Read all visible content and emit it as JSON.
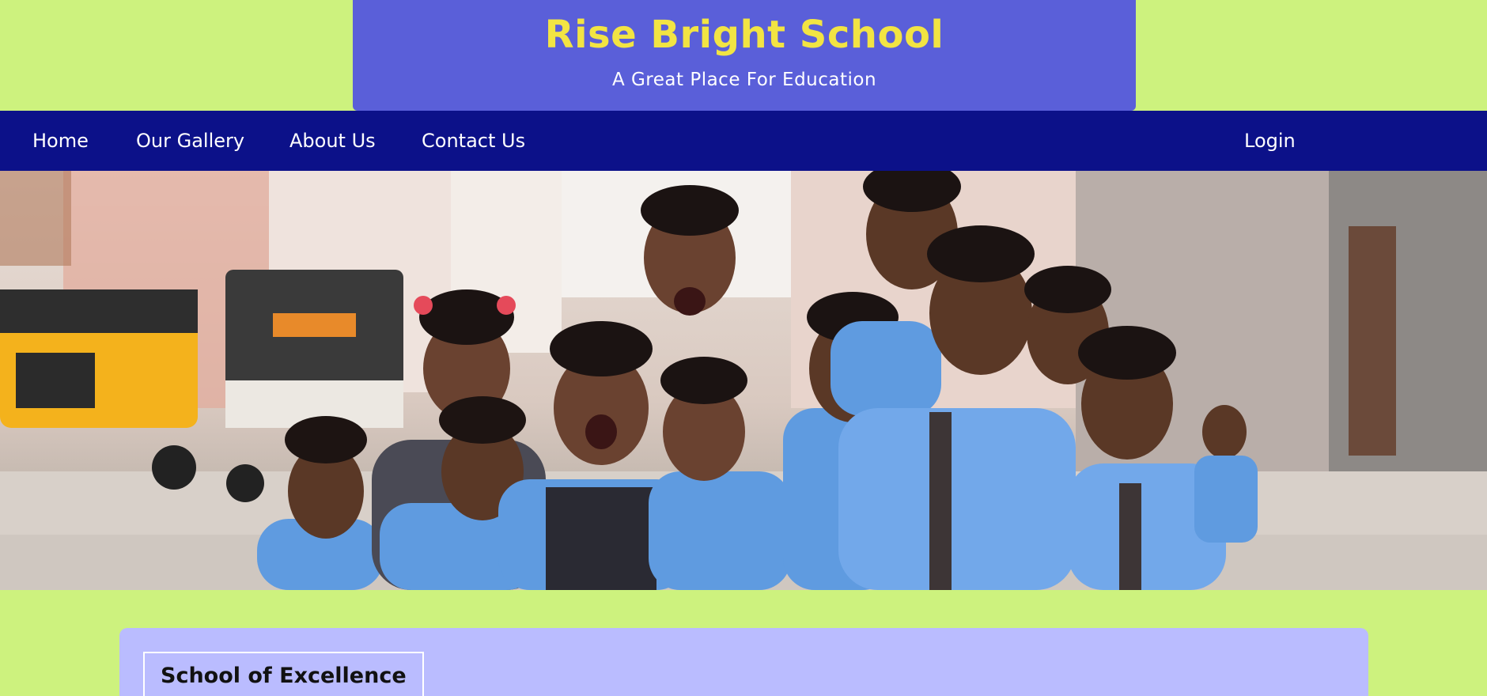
{
  "header": {
    "title": "Rise Bright School",
    "tagline": "A Great Place For Education"
  },
  "nav": {
    "items": [
      "Home",
      "Our Gallery",
      "About Us",
      "Contact Us"
    ],
    "login": "Login"
  },
  "hero": {
    "image": "group of laughing schoolchildren in blue uniforms on a city street"
  },
  "section": {
    "heading": "School of Excellence"
  },
  "colors": {
    "page_background": "#cdf27e",
    "header_background": "#5a5fd9",
    "title_color": "#f2e443",
    "nav_background": "#0c1189",
    "panel_background": "#babcff"
  }
}
